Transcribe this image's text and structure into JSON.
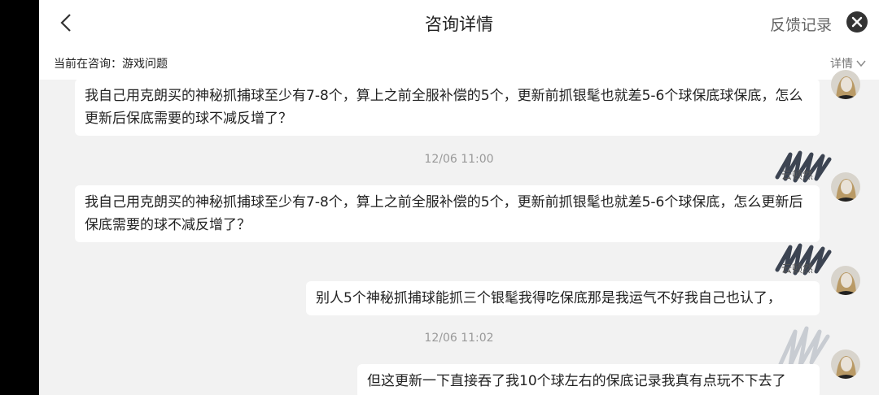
{
  "header": {
    "title": "咨询详情",
    "feedback_label": "反馈记录"
  },
  "subbar": {
    "consult_text": "当前在咨询：游戏问题",
    "detail_label": "详情"
  },
  "messages": [
    {
      "text": "我自己用克朗买的神秘抓捕球至少有7-8个，算上之前全服补偿的5个，更新前抓银髦也就差5-6个球保底球保底，怎么更新后保底需要的球不减反增了？"
    },
    {
      "text": "我自己用克朗买的神秘抓捕球至少有7-8个，算上之前全服补偿的5个，更新前抓银髦也就差5-6个球保底，怎么更新后保底需要的球不减反增了？"
    },
    {
      "text": "别人5个神秘抓捕球能抓三个银髦我得吃保底那是我运气不好我自己也认了，"
    },
    {
      "text": "但这更新一下直接吞了我10个球左右的保底记录我真有点玩不下去了"
    }
  ],
  "timestamps": [
    "12/06 11:00",
    "12/06 11:02"
  ],
  "usernames": [
    "云顿然",
    "云顿然"
  ],
  "colors": {
    "background": "#f2f2f2",
    "bubble": "#ffffff",
    "scribble": "#3c4452"
  }
}
